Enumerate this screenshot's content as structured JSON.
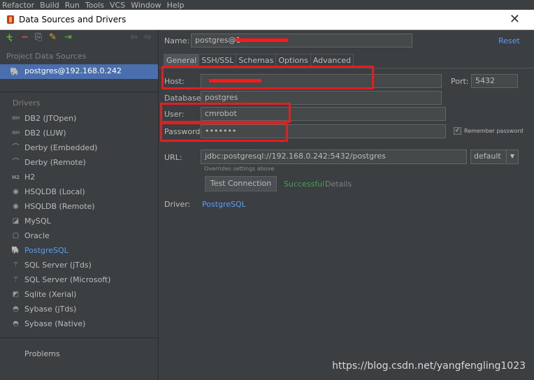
{
  "menubar": {
    "items": [
      "Refactor",
      "Build",
      "Run",
      "Tools",
      "VCS",
      "Window",
      "Help"
    ]
  },
  "window": {
    "title": "Data Sources and Drivers",
    "close": "✕"
  },
  "left": {
    "toolbar": {
      "add": "+",
      "remove": "−",
      "copy": "⎘",
      "config": "✎",
      "import": "⇥",
      "back": "⇦",
      "forward": "⇨"
    },
    "project_label": "Project Data Sources",
    "datasource": "postgres@192.168.0.242",
    "drivers_label": "Drivers",
    "drivers": [
      {
        "label": "DB2 (JTOpen)",
        "icon": "IBM"
      },
      {
        "label": "DB2 (LUW)",
        "icon": "IBM"
      },
      {
        "label": "Derby (Embedded)",
        "icon": "⌒"
      },
      {
        "label": "Derby (Remote)",
        "icon": "⌒"
      },
      {
        "label": "H2",
        "icon": "H2"
      },
      {
        "label": "HSQLDB (Local)",
        "icon": "◉"
      },
      {
        "label": "HSQLDB (Remote)",
        "icon": "◉"
      },
      {
        "label": "MySQL",
        "icon": "◪"
      },
      {
        "label": "Oracle",
        "icon": "▢"
      },
      {
        "label": "PostgreSQL",
        "icon": "🐘"
      },
      {
        "label": "SQL Server (jTds)",
        "icon": "⚚"
      },
      {
        "label": "SQL Server (Microsoft)",
        "icon": "⚚"
      },
      {
        "label": "Sqlite (Xerial)",
        "icon": "◩"
      },
      {
        "label": "Sybase (jTds)",
        "icon": "◓"
      },
      {
        "label": "Sybase (Native)",
        "icon": "◓"
      }
    ],
    "problems": "Problems"
  },
  "right": {
    "name_label": "Name:",
    "name_value": "postgres@1",
    "reset": "Reset",
    "tabs": [
      "General",
      "SSH/SSL",
      "Schemas",
      "Options",
      "Advanced"
    ],
    "host_label": "Host:",
    "host_value": "",
    "port_label": "Port:",
    "port_value": "5432",
    "database_label": "Database:",
    "database_value": "postgres",
    "user_label": "User:",
    "user_value": "cmrobot",
    "password_label": "Password:",
    "password_value": "•••••••",
    "remember_label": "Remember password",
    "remember_checked": "✓",
    "url_label": "URL:",
    "url_value": "jdbc:postgresql://192.168.0.242:5432/postgres",
    "url_mode": "default",
    "url_hint": "Overrides settings above",
    "test_button": "Test Connection",
    "test_status": "Successful",
    "details": "Details",
    "driver_label": "Driver:",
    "driver_value": "PostgreSQL"
  },
  "watermark": "https://blog.csdn.net/yangfengling1023",
  "colors": {
    "accent": "#589df6",
    "selection": "#4b6eaf",
    "success": "#499c54",
    "highlight": "#e02020"
  }
}
